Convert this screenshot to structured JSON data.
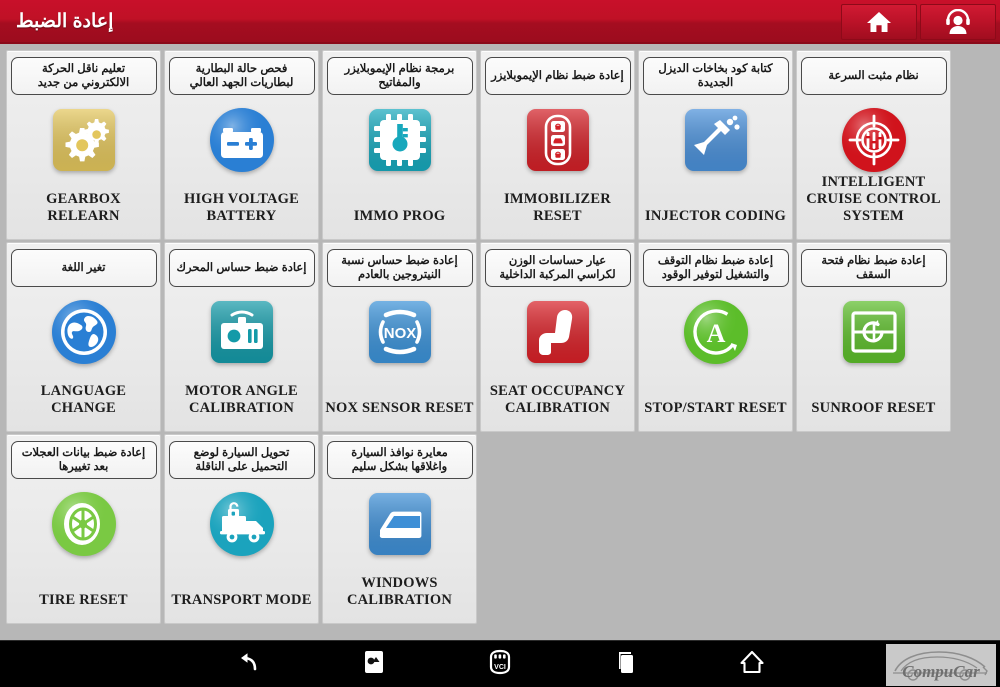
{
  "header": {
    "title": "إعادة الضبط",
    "buttons": [
      {
        "name": "home-button",
        "icon": "home-icon"
      },
      {
        "name": "support-button",
        "icon": "headset-user-icon"
      }
    ]
  },
  "grid": {
    "cards": [
      {
        "arabic": "تعليم ناقل الحركة الالكتروني من جديد",
        "title": "GEARBOX RELEARN",
        "icon": "gears-icon",
        "icon_shape": "rounded-square",
        "color": "#e3c65c"
      },
      {
        "arabic": "فحص حالة البطارية لبطاريات الجهد العالي",
        "title": "HIGH VOLTAGE BATTERY",
        "icon": "battery-icon",
        "icon_shape": "circle",
        "color": "#2a7fd4"
      },
      {
        "arabic": "برمجة نظام الإيموبلايزر والمفاتيح",
        "title": "IMMO PROG",
        "icon": "chip-key-icon",
        "icon_shape": "rounded-square",
        "color": "#17a8bc"
      },
      {
        "arabic": "إعادة ضبط نظام الإيموبلايزر",
        "title": "IMMOBILIZER RESET",
        "icon": "car-key-fob-icon",
        "icon_shape": "rounded-square",
        "color": "#d32027"
      },
      {
        "arabic": "كتابة كود بخاخات الديزل الجديدة",
        "title": "INJECTOR CODING",
        "icon": "injector-icon",
        "icon_shape": "rounded-square",
        "color": "#4a90d9"
      },
      {
        "arabic": "نظام مثبت السرعة",
        "title": "INTELLIGENT CRUISE CONTROL SYSTEM",
        "icon": "radar-target-icon",
        "icon_shape": "circle",
        "color": "#d0131c"
      },
      {
        "arabic": "تغير اللغة",
        "title": "LANGUAGE CHANGE",
        "icon": "globe-icon",
        "icon_shape": "circle",
        "color": "#2a7fd4"
      },
      {
        "arabic": "إعادة ضبط حساس المحرك",
        "title": "MOTOR ANGLE CALIBRATION",
        "icon": "motor-sensor-icon",
        "icon_shape": "rounded-square",
        "color": "#149aa8"
      },
      {
        "arabic": "إعادة ضبط حساس نسبة النيتروجين بالعادم",
        "title": "NOX SENSOR RESET",
        "icon": "nox-icon",
        "icon_shape": "rounded-square",
        "color": "#3b92d8"
      },
      {
        "arabic": "عيار حساسات الوزن لكراسي المركبة الداخلية",
        "title": "SEAT OCCUPANCY CALIBRATION",
        "icon": "car-seat-icon",
        "icon_shape": "rounded-square",
        "color": "#d82027"
      },
      {
        "arabic": "إعادة ضبط نظام التوقف والتشغيل لتوفير الوقود",
        "title": "STOP/START RESET",
        "icon": "auto-start-stop-icon",
        "icon_shape": "circle",
        "color": "#5cbd2a"
      },
      {
        "arabic": "إعادة ضبط نظام فتحة السقف",
        "title": "SUNROOF RESET",
        "icon": "sunroof-icon",
        "icon_shape": "rounded-square",
        "color": "#5cbd2a"
      },
      {
        "arabic": "إعادة ضبط بيانات العجلات بعد تغييرها",
        "title": "TIRE RESET",
        "icon": "tire-icon",
        "icon_shape": "circle",
        "color": "#7ac943"
      },
      {
        "arabic": "تحويل السيارة لوضع التحميل على الناقلة",
        "title": "TRANSPORT MODE",
        "icon": "truck-lock-icon",
        "icon_shape": "circle",
        "color": "#1ba3bd"
      },
      {
        "arabic": "معايرة نوافذ السيارة واغلاقها بشكل سليم",
        "title": "WINDOWS CALIBRATION",
        "icon": "car-window-icon",
        "icon_shape": "rounded-square",
        "color": "#3e8fd6"
      }
    ]
  },
  "navbar": {
    "buttons": [
      {
        "name": "back-button",
        "icon": "back-arrow-icon"
      },
      {
        "name": "screenshot-button",
        "icon": "image-icon"
      },
      {
        "name": "vci-button",
        "icon": "vci-connector-icon",
        "label": "VCI"
      },
      {
        "name": "recents-button",
        "icon": "recent-apps-icon"
      },
      {
        "name": "home-nav-button",
        "icon": "home-outline-icon"
      }
    ],
    "watermark": "CompuCar"
  },
  "colors": {
    "header_red": "#c0102a",
    "page_background": "#b7b7b7",
    "card_background": "#ebebeb",
    "navbar_black": "#000000"
  }
}
